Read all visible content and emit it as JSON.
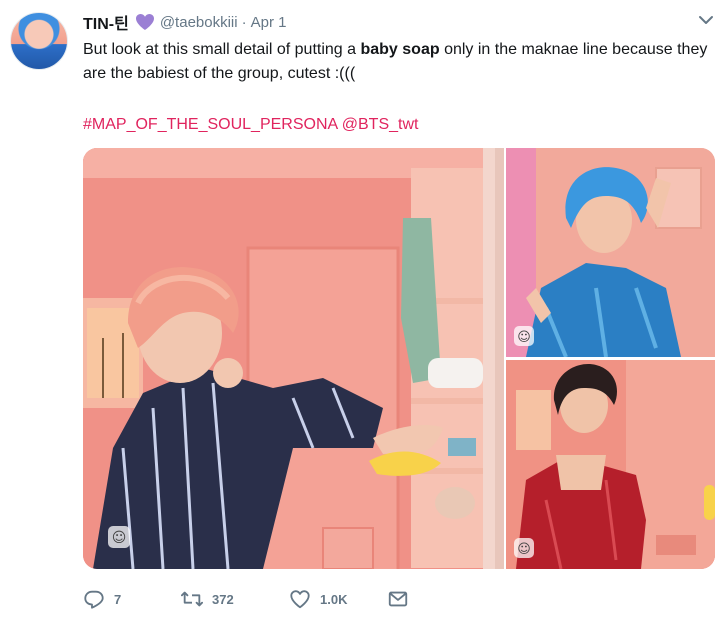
{
  "tweet": {
    "display_name": "TIN-틴",
    "handle": "@taebokkiii",
    "separator": "·",
    "time": "Apr 1",
    "text_before": "But look at this small detail of putting a ",
    "text_bold": "baby soap",
    "text_after": " only in the maknae line because they are the babiest of the group, cutest :(((",
    "hashtag": "#MAP_OF_THE_SOUL_PERSONA",
    "mention": "@BTS_twt"
  },
  "colors": {
    "heart": "#9b7fd4",
    "link": "#e0245e",
    "muted": "#657786"
  },
  "actions": {
    "reply_count": "7",
    "retweet_count": "372",
    "like_count": "1.0K"
  },
  "icons": [
    "purple-heart-icon",
    "chevron-down-icon",
    "reply-icon",
    "retweet-icon",
    "like-icon",
    "share-icon",
    "pointing-hand-icon",
    "media-tag-icon"
  ]
}
